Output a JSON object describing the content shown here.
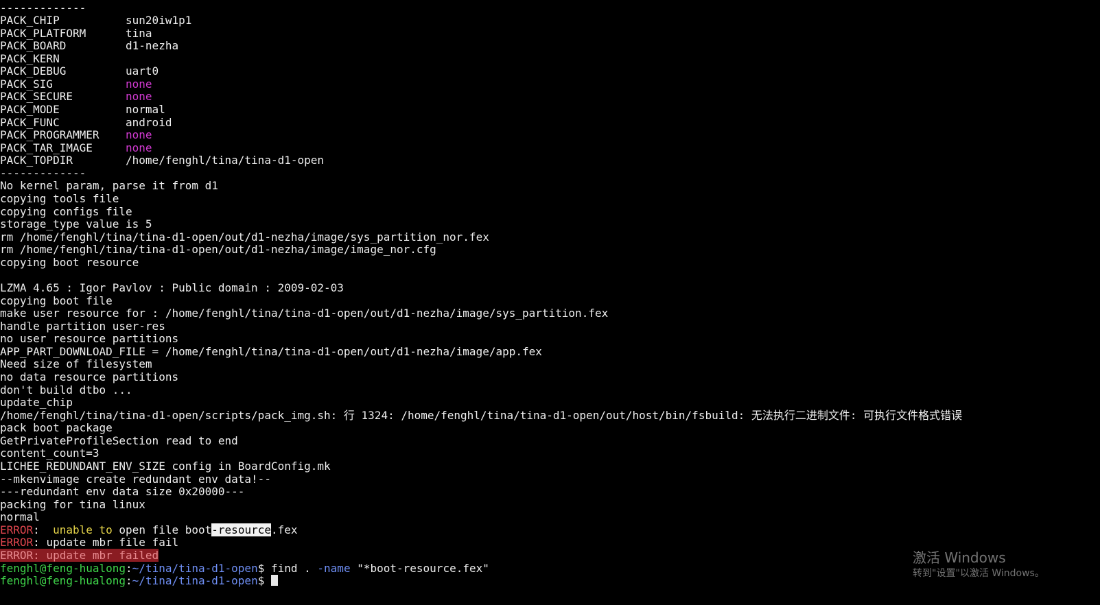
{
  "colors": {
    "background": "#000000",
    "text": "#eeeeee",
    "magenta": "#d23ad2",
    "error_red": "#e0454d",
    "warning_yellow": "#e6d54a",
    "prompt_green": "#3fd64a",
    "prompt_blue": "#6f8ff5"
  },
  "terminal": {
    "lines": [
      [
        {
          "t": "-------------",
          "c": "plain"
        }
      ],
      [
        {
          "t": "PACK_CHIP          sun20iw1p1",
          "c": "plain"
        }
      ],
      [
        {
          "t": "PACK_PLATFORM      tina",
          "c": "plain"
        }
      ],
      [
        {
          "t": "PACK_BOARD         d1-nezha",
          "c": "plain"
        }
      ],
      [
        {
          "t": "PACK_KERN",
          "c": "plain"
        }
      ],
      [
        {
          "t": "PACK_DEBUG         uart0",
          "c": "plain"
        }
      ],
      [
        {
          "t": "PACK_SIG           ",
          "c": "plain"
        },
        {
          "t": "none",
          "c": "magenta"
        }
      ],
      [
        {
          "t": "PACK_SECURE        ",
          "c": "plain"
        },
        {
          "t": "none",
          "c": "magenta"
        }
      ],
      [
        {
          "t": "PACK_MODE          normal",
          "c": "plain"
        }
      ],
      [
        {
          "t": "PACK_FUNC          android",
          "c": "plain"
        }
      ],
      [
        {
          "t": "PACK_PROGRAMMER    ",
          "c": "plain"
        },
        {
          "t": "none",
          "c": "magenta"
        }
      ],
      [
        {
          "t": "PACK_TAR_IMAGE     ",
          "c": "plain"
        },
        {
          "t": "none",
          "c": "magenta"
        }
      ],
      [
        {
          "t": "PACK_TOPDIR        /home/fenghl/tina/tina-d1-open",
          "c": "plain"
        }
      ],
      [
        {
          "t": "-------------",
          "c": "plain"
        }
      ],
      [
        {
          "t": "No kernel param, parse it from d1",
          "c": "plain"
        }
      ],
      [
        {
          "t": "copying tools file",
          "c": "plain"
        }
      ],
      [
        {
          "t": "copying configs file",
          "c": "plain"
        }
      ],
      [
        {
          "t": "storage_type value is 5",
          "c": "plain"
        }
      ],
      [
        {
          "t": "rm /home/fenghl/tina/tina-d1-open/out/d1-nezha/image/sys_partition_nor.fex",
          "c": "plain"
        }
      ],
      [
        {
          "t": "rm /home/fenghl/tina/tina-d1-open/out/d1-nezha/image/image_nor.cfg",
          "c": "plain"
        }
      ],
      [
        {
          "t": "copying boot resource",
          "c": "plain"
        }
      ],
      [
        {
          "t": "",
          "c": "plain"
        }
      ],
      [
        {
          "t": "LZMA 4.65 : Igor Pavlov : Public domain : 2009-02-03",
          "c": "plain"
        }
      ],
      [
        {
          "t": "copying boot file",
          "c": "plain"
        }
      ],
      [
        {
          "t": "make user resource for : /home/fenghl/tina/tina-d1-open/out/d1-nezha/image/sys_partition.fex",
          "c": "plain"
        }
      ],
      [
        {
          "t": "handle partition user-res",
          "c": "plain"
        }
      ],
      [
        {
          "t": "no user resource partitions",
          "c": "plain"
        }
      ],
      [
        {
          "t": "APP_PART_DOWNLOAD_FILE = /home/fenghl/tina/tina-d1-open/out/d1-nezha/image/app.fex",
          "c": "plain"
        }
      ],
      [
        {
          "t": "Need size of filesystem",
          "c": "plain"
        }
      ],
      [
        {
          "t": "no data resource partitions",
          "c": "plain"
        }
      ],
      [
        {
          "t": "don't build dtbo ...",
          "c": "plain"
        }
      ],
      [
        {
          "t": "update_chip",
          "c": "plain"
        }
      ],
      [
        {
          "t": "/home/fenghl/tina/tina-d1-open/scripts/pack_img.sh: 行 1324: /home/fenghl/tina/tina-d1-open/out/host/bin/fsbuild: 无法执行二进制文件: 可执行文件格式错误",
          "c": "plain"
        }
      ],
      [
        {
          "t": "pack boot package",
          "c": "plain"
        }
      ],
      [
        {
          "t": "GetPrivateProfileSection read to end",
          "c": "plain"
        }
      ],
      [
        {
          "t": "content_count=3",
          "c": "plain"
        }
      ],
      [
        {
          "t": "LICHEE_REDUNDANT_ENV_SIZE config in BoardConfig.mk",
          "c": "plain"
        }
      ],
      [
        {
          "t": "--mkenvimage create redundant env data!--",
          "c": "plain"
        }
      ],
      [
        {
          "t": "---redundant env data size 0x20000---",
          "c": "plain"
        }
      ],
      [
        {
          "t": "packing for tina linux",
          "c": "plain"
        }
      ],
      [
        {
          "t": "normal",
          "c": "plain"
        }
      ],
      [
        {
          "t": "ERROR",
          "c": "red"
        },
        {
          "t": ":  ",
          "c": "plain"
        },
        {
          "t": "unable to",
          "c": "yellow"
        },
        {
          "t": " open file boot",
          "c": "plain"
        },
        {
          "t": "-resource",
          "c": "hl"
        },
        {
          "t": ".fex",
          "c": "plain"
        }
      ],
      [
        {
          "t": "ERROR",
          "c": "red"
        },
        {
          "t": ": update mbr file fail",
          "c": "plain"
        }
      ],
      [
        {
          "t": "ERROR: update mbr failed",
          "c": "errbg"
        }
      ],
      [
        {
          "t": "fenghl@feng-hualong",
          "c": "green"
        },
        {
          "t": ":",
          "c": "plain"
        },
        {
          "t": "~/tina/tina-d1-open",
          "c": "blue"
        },
        {
          "t": "$ find . ",
          "c": "plain"
        },
        {
          "t": "-name",
          "c": "optblue"
        },
        {
          "t": " \"*boot-resource.fex\"",
          "c": "plain"
        }
      ],
      [
        {
          "t": "fenghl@feng-hualong",
          "c": "green"
        },
        {
          "t": ":",
          "c": "plain"
        },
        {
          "t": "~/tina/tina-d1-open",
          "c": "blue"
        },
        {
          "t": "$ ",
          "c": "plain"
        },
        {
          "t": "",
          "c": "cursor"
        }
      ]
    ]
  },
  "watermark": {
    "title": "激活 Windows",
    "subtitle": "转到\"设置\"以激活 Windows。"
  }
}
